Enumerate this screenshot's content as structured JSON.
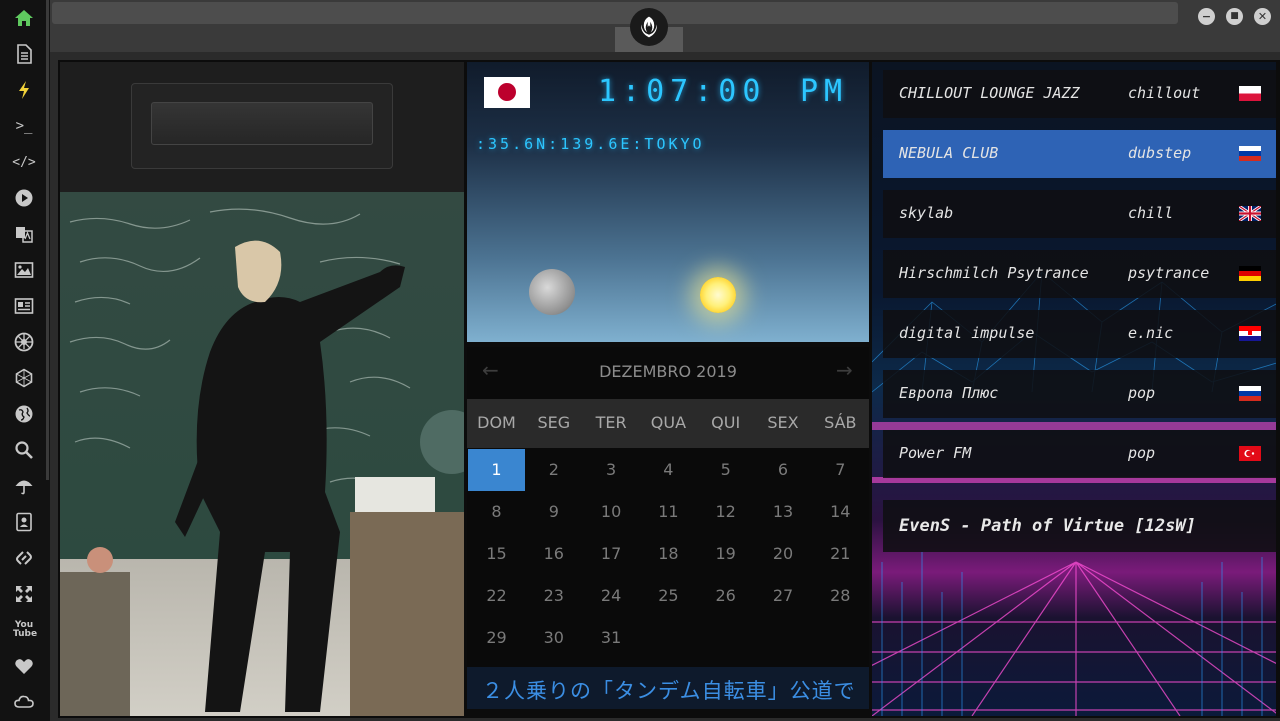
{
  "sidebar": {
    "items": [
      {
        "icon": "home-icon",
        "color": "#5fc95f"
      },
      {
        "icon": "document-icon"
      },
      {
        "icon": "lightning-icon",
        "color": "#f2d33a"
      },
      {
        "icon": "terminal-icon",
        "label": ">_"
      },
      {
        "icon": "code-icon",
        "label": "</>"
      },
      {
        "icon": "play-circle-icon"
      },
      {
        "icon": "translate-icon"
      },
      {
        "icon": "image-icon"
      },
      {
        "icon": "newspaper-icon"
      },
      {
        "icon": "galactic-empire-icon"
      },
      {
        "icon": "hexagon-icon"
      },
      {
        "icon": "globe-icon"
      },
      {
        "icon": "search-icon"
      },
      {
        "icon": "umbrella-icon"
      },
      {
        "icon": "contact-card-icon"
      },
      {
        "icon": "link-icon"
      },
      {
        "icon": "expand-arrows-icon"
      },
      {
        "icon": "youtube-icon",
        "label": "You Tube"
      },
      {
        "icon": "heart-icon"
      },
      {
        "icon": "cloud-icon"
      }
    ]
  },
  "window": {
    "logo": "rebel-alliance-icon",
    "buttons": [
      {
        "icon": "minimize-icon",
        "label": "−"
      },
      {
        "icon": "maximize-icon",
        "label": "■"
      },
      {
        "icon": "close-icon",
        "label": "✕"
      }
    ]
  },
  "clock": {
    "country_flag": "japan-flag-icon",
    "time": "1:07:00",
    "ampm": "PM",
    "location": ":35.6N:139.6E:TOKYO"
  },
  "calendar": {
    "title": "DEZEMBRO 2019",
    "prev": "←",
    "next": "→",
    "weekdays": [
      "DOM",
      "SEG",
      "TER",
      "QUA",
      "QUI",
      "SEX",
      "SÁB"
    ],
    "days": [
      "1",
      "2",
      "3",
      "4",
      "5",
      "6",
      "7",
      "8",
      "9",
      "10",
      "11",
      "12",
      "13",
      "14",
      "15",
      "16",
      "17",
      "18",
      "19",
      "20",
      "21",
      "22",
      "23",
      "24",
      "25",
      "26",
      "27",
      "28",
      "29",
      "30",
      "31"
    ],
    "selected": "1"
  },
  "ticker": {
    "text": "２人乗りの「タンデム自転車」公道で"
  },
  "radio": {
    "stations": [
      {
        "name": "CHILLOUT LOUNGE JAZZ",
        "genre": "chillout",
        "flag": "poland-flag-icon"
      },
      {
        "name": "NEBULA CLUB",
        "genre": "dubstep",
        "flag": "russia-flag-icon",
        "selected": true
      },
      {
        "name": "skylab",
        "genre": "chill",
        "flag": "uk-flag-icon"
      },
      {
        "name": "Hirschmilch Psytrance",
        "genre": "psytrance",
        "flag": "germany-flag-icon"
      },
      {
        "name": "digital impulse",
        "genre": "e.nic",
        "flag": "croatia-flag-icon"
      },
      {
        "name": "Европа Плюс",
        "genre": "pop",
        "flag": "russia-flag-icon"
      },
      {
        "name": "Power FM",
        "genre": "pop",
        "flag": "turkey-flag-icon"
      }
    ],
    "now_playing": "EvenS - Path of Virtue [12sW]"
  },
  "colors": {
    "accent": "#3a86d0",
    "lcd": "#2cc6ff",
    "selected_row": "#2e63b5",
    "ticker": "#3b8ee3"
  }
}
